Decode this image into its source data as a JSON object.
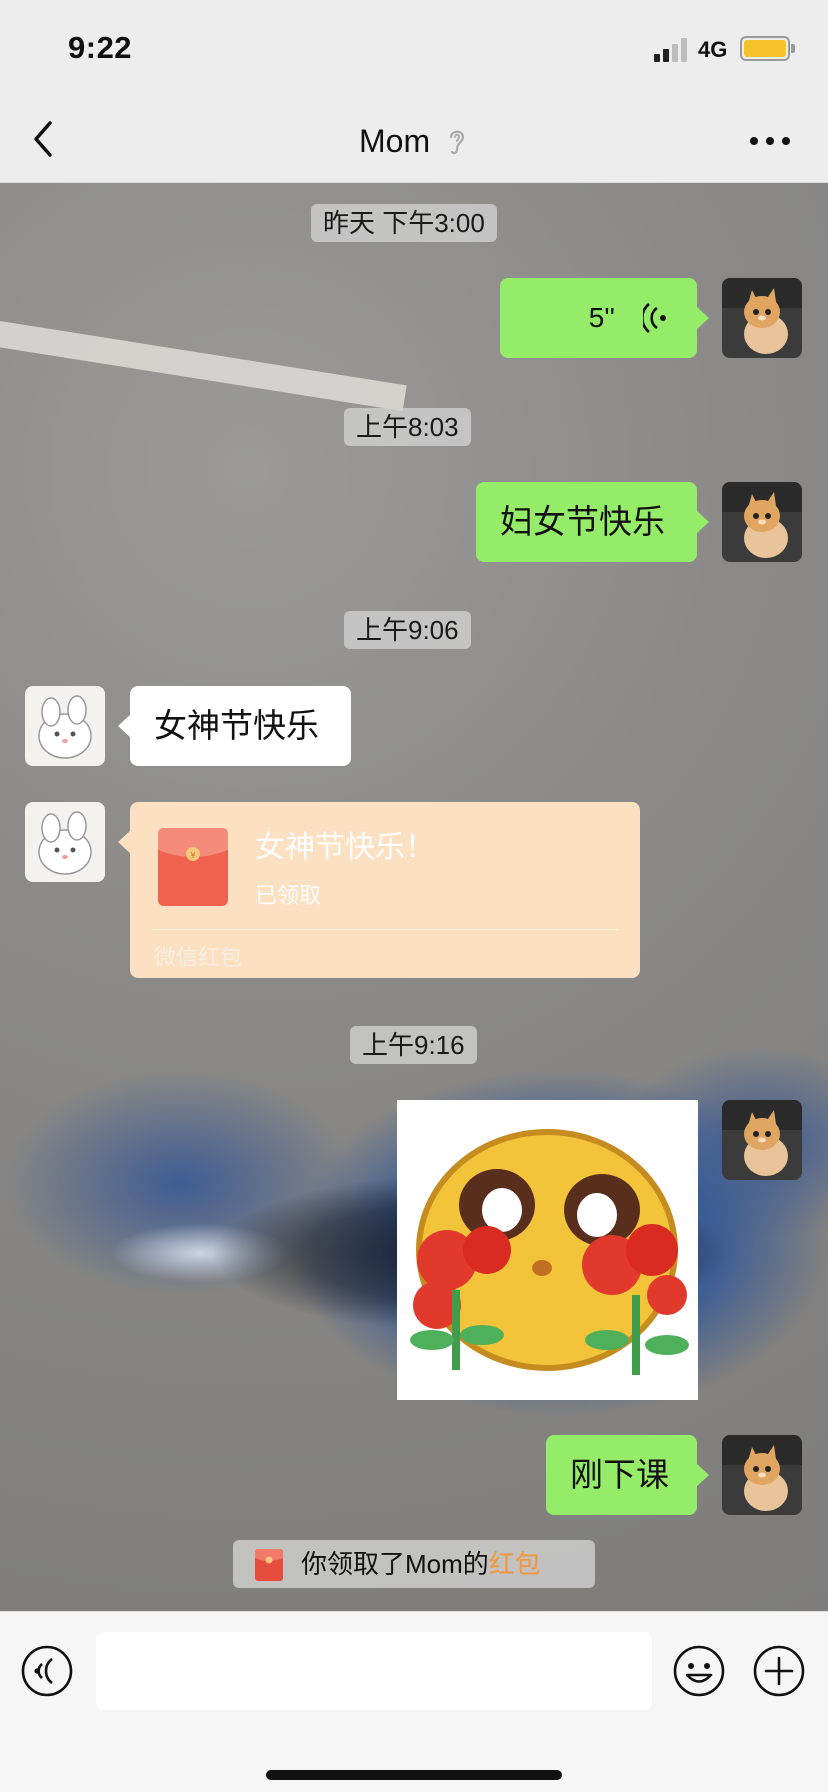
{
  "status_bar": {
    "time": "9:22",
    "network": "4G",
    "battery_color": "#f5c22a"
  },
  "nav": {
    "title": "Mom",
    "back_icon": "chevron-left-icon",
    "ear_icon": "ear-icon",
    "more_icon": "more-icon"
  },
  "messages": {
    "ts1": "昨天 下午3:00",
    "voice_duration": "5''",
    "ts2": "上午8:03",
    "msg_womens_day": "妇女节快乐",
    "ts3": "上午9:06",
    "msg_goddess_day": "女神节快乐",
    "red_packet": {
      "title": "女神节快乐！",
      "status": "已领取",
      "footer": "微信红包"
    },
    "ts4": "上午9:16",
    "msg_class_over": "刚下课"
  },
  "notice": {
    "text": "你领取了Mom的",
    "link": "红包"
  },
  "input_bar": {
    "input_value": "",
    "voice_icon": "voice-toggle-icon",
    "emoji_icon": "emoji-icon",
    "plus_icon": "plus-icon"
  },
  "colors": {
    "my_bubble": "#95ec69",
    "their_bubble": "#ffffff",
    "red_packet_bg": "#fbe0c2",
    "link_orange": "#f2973d"
  }
}
